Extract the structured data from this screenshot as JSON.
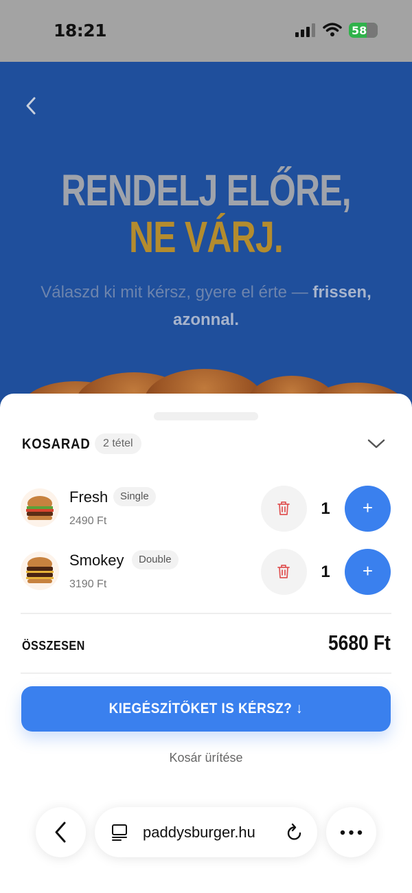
{
  "status_bar": {
    "time": "18:21",
    "battery": "58"
  },
  "hero": {
    "title_line1": "RENDELJ ELŐRE,",
    "title_line2": "NE VÁRJ.",
    "subtitle_plain": "Válaszd ki mit kérsz, gyere el érte — ",
    "subtitle_bold1": "frissen,",
    "subtitle_bold2": "azonnal."
  },
  "cart": {
    "title": "KOSARAD",
    "item_count": "2 tétel",
    "items": [
      {
        "name": "Fresh",
        "variant": "Single",
        "price": "2490 Ft",
        "qty": "1",
        "plus": "+"
      },
      {
        "name": "Smokey",
        "variant": "Double",
        "price": "3190 Ft",
        "qty": "1",
        "plus": "+"
      }
    ],
    "total_label": "ÖSSZESEN",
    "total_value": "5680 Ft",
    "cta_label": "KIEGÉSZÍTŐKET IS KÉRSZ? ↓",
    "empty_label": "Kosár ürítése"
  },
  "browser": {
    "url": "paddysburger.hu"
  },
  "colors": {
    "hero_bg": "#1f4f9c",
    "accent_gold": "#b48c2e",
    "primary_blue": "#3a80ee",
    "trash_red": "#e05555"
  },
  "icons": [
    "back-chevron-icon",
    "chevron-down-icon",
    "trash-icon",
    "plus-icon",
    "reader-icon",
    "reload-icon",
    "more-icon"
  ]
}
